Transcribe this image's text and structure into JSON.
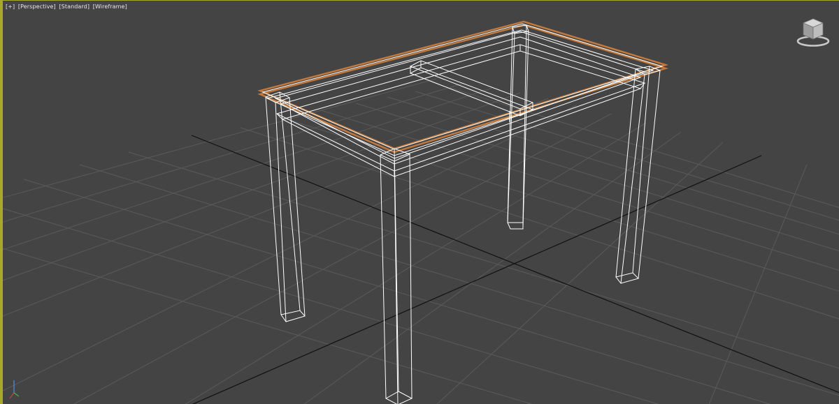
{
  "viewport": {
    "labels": {
      "plus": "[+]",
      "view": "[Perspective]",
      "shading_preset": "[Standard]",
      "shading_mode": "[Wireframe]"
    },
    "colors": {
      "background": "#444444",
      "grid": "#5a5a5a",
      "grid_axis": "#111111",
      "wireframe": "#ffffff",
      "selected_wire": "#c47a3c",
      "active_border": "#a8a82a"
    },
    "icons": {
      "viewcube": "viewcube-icon",
      "axis": "axis-tripod-icon"
    }
  }
}
